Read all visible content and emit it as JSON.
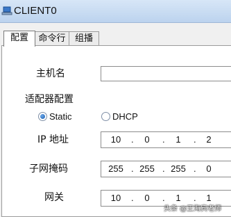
{
  "window": {
    "title": "CLIENT0",
    "icon": "laptop-icon"
  },
  "tabs": [
    {
      "label": "配置",
      "active": true
    },
    {
      "label": "命令行",
      "active": false
    },
    {
      "label": "组播",
      "active": false
    }
  ],
  "form": {
    "hostname_label": "主机名",
    "hostname_value": "",
    "adapter_section_label": "适配器配置",
    "mode": {
      "static_label": "Static",
      "dhcp_label": "DHCP",
      "selected": "Static"
    },
    "ip": {
      "label": "IP 地址",
      "octets": [
        "10",
        "0",
        "1",
        "2"
      ]
    },
    "mask": {
      "label": "子网掩码",
      "octets": [
        "255",
        "255",
        "255",
        "0"
      ]
    },
    "gateway": {
      "label": "网关",
      "octets": [
        "10",
        "0",
        "1",
        "1"
      ]
    }
  },
  "watermark": "头条 @王海宾老师",
  "colors": {
    "radio_selected": "#1b5fb0",
    "titlebar": "#c8dcf2"
  }
}
